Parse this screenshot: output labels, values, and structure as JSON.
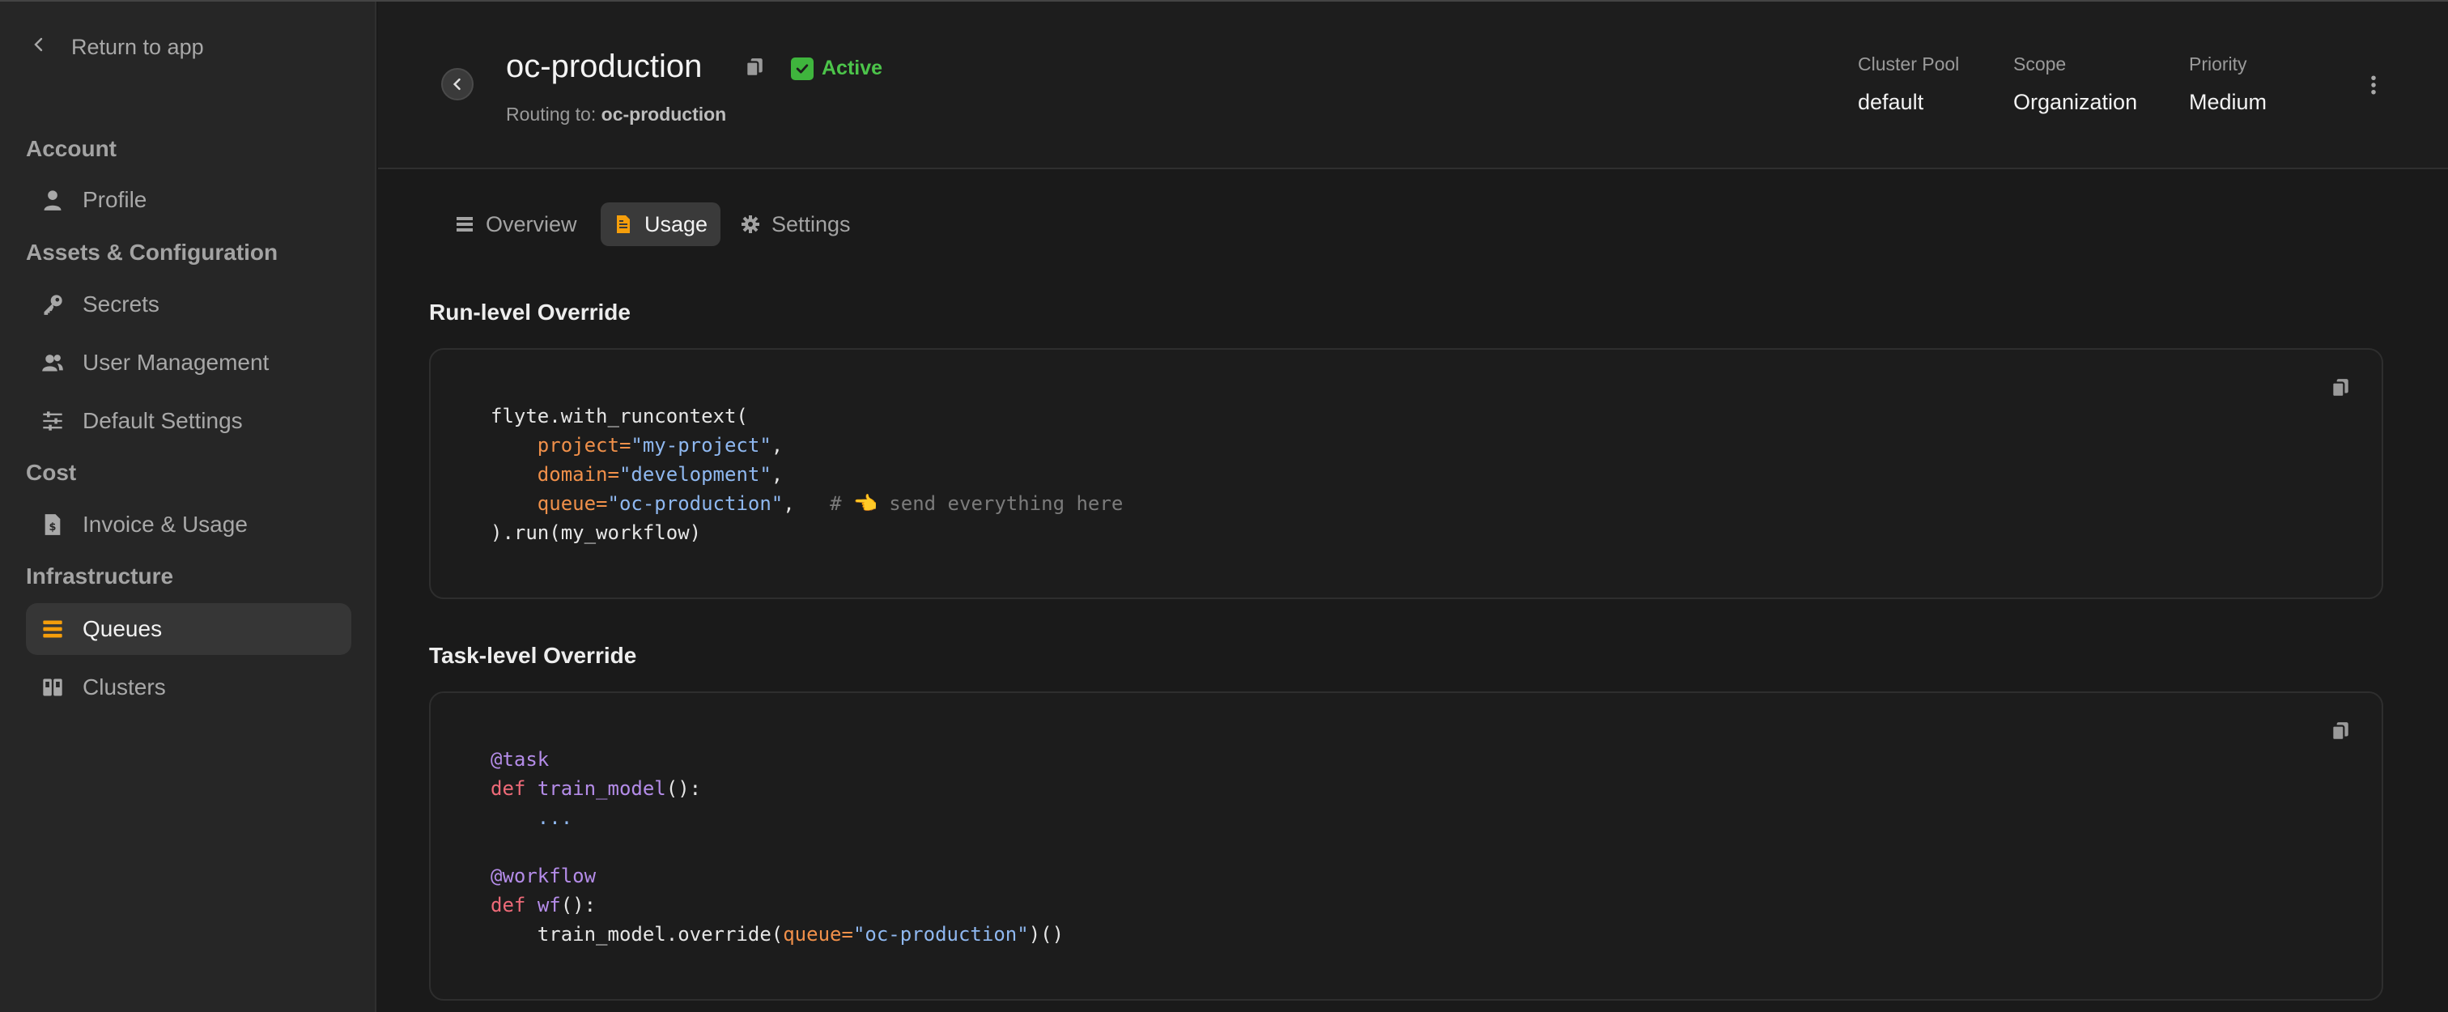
{
  "sidebar": {
    "return_label": "Return to app",
    "sections": [
      {
        "title": "Account",
        "items": [
          {
            "label": "Profile",
            "icon": "user-icon"
          }
        ]
      },
      {
        "title": "Assets & Configuration",
        "items": [
          {
            "label": "Secrets",
            "icon": "key-icon"
          },
          {
            "label": "User Management",
            "icon": "users-icon"
          },
          {
            "label": "Default Settings",
            "icon": "sliders-icon"
          }
        ]
      },
      {
        "title": "Cost",
        "items": [
          {
            "label": "Invoice & Usage",
            "icon": "invoice-icon"
          }
        ]
      },
      {
        "title": "Infrastructure",
        "items": [
          {
            "label": "Queues",
            "icon": "queues-icon",
            "active": true
          },
          {
            "label": "Clusters",
            "icon": "clusters-icon"
          }
        ]
      }
    ]
  },
  "header": {
    "title": "oc-production",
    "status": "Active",
    "routing_label": "Routing to:",
    "routing_value": "oc-production",
    "meta": [
      {
        "label": "Cluster Pool",
        "value": "default"
      },
      {
        "label": "Scope",
        "value": "Organization"
      },
      {
        "label": "Priority",
        "value": "Medium"
      }
    ]
  },
  "tabs": [
    {
      "label": "Overview",
      "icon": "list-icon"
    },
    {
      "label": "Usage",
      "icon": "document-icon",
      "active": true
    },
    {
      "label": "Settings",
      "icon": "gear-icon"
    }
  ],
  "run_override": {
    "title": "Run-level Override",
    "code": {
      "l1": "flyte.with_runcontext(",
      "l2_key": "project=",
      "l2_val": "\"my-project\"",
      "l2_tail": ",",
      "l3_key": "domain=",
      "l3_val": "\"development\"",
      "l3_tail": ",",
      "l4_key": "queue=",
      "l4_val": "\"oc-production\"",
      "l4_tail": ",",
      "l4_comment": "# 👈 send everything here",
      "l5": ").run(my_workflow)"
    }
  },
  "task_override": {
    "title": "Task-level Override",
    "code": {
      "l1": "@task",
      "l2_kw": "def",
      "l2_fn": "train_model",
      "l2_tail": "():",
      "l3": "...",
      "l5": "@workflow",
      "l6_kw": "def",
      "l6_fn": "wf",
      "l6_tail": "():",
      "l7_head": "train_model.override(",
      "l7_key": "queue=",
      "l7_val": "\"oc-production\"",
      "l7_tail": ")()"
    }
  },
  "colors": {
    "accent_orange": "#f59e0b",
    "status_green": "#3fb53d",
    "background": "#1a1a1a",
    "sidebar": "#262626"
  }
}
